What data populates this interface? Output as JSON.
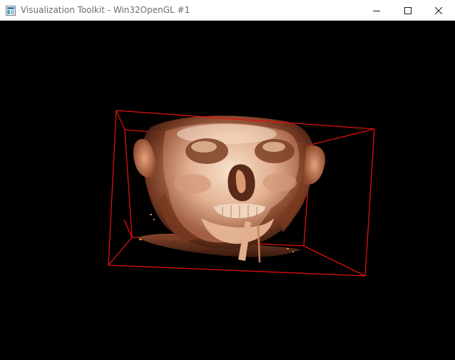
{
  "window": {
    "title": "Visualization Toolkit - Win32OpenGL #1",
    "app_icon": "vtk-window-icon",
    "controls": {
      "minimize_icon": "minimize-icon",
      "maximize_icon": "maximize-icon",
      "close_icon": "close-icon"
    }
  },
  "render": {
    "background_color": "#000000",
    "outline_color": "#e01010",
    "content": "volume-rendered-head"
  }
}
